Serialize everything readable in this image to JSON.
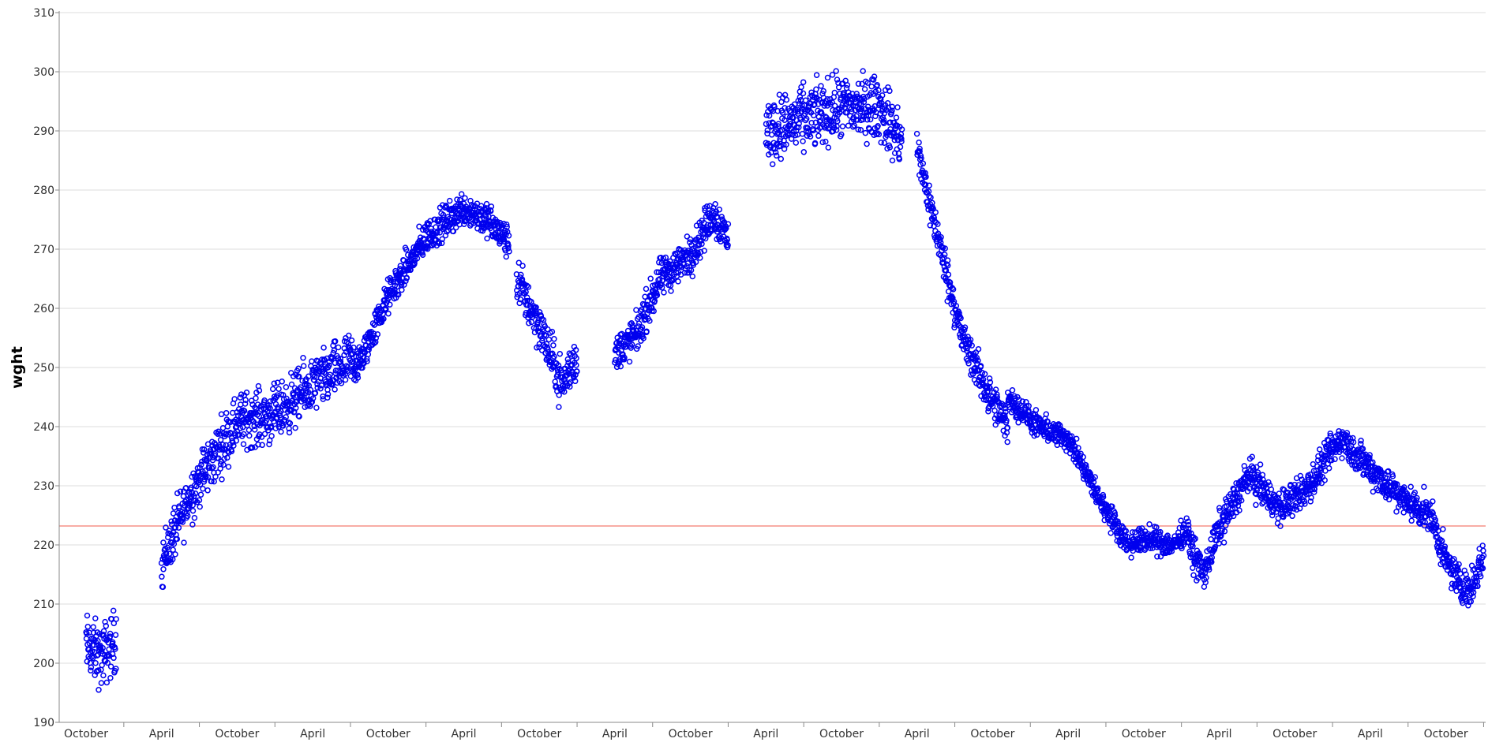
{
  "chart_data": {
    "type": "scatter",
    "ylabel": "wght",
    "xlabel": "",
    "ylim": [
      190,
      310
    ],
    "y_ticks": [
      190,
      200,
      210,
      220,
      230,
      240,
      250,
      260,
      270,
      280,
      290,
      300,
      310
    ],
    "x_ticks": [
      "October",
      "April",
      "October",
      "April",
      "October",
      "April",
      "October",
      "April",
      "October",
      "April",
      "October",
      "April",
      "October",
      "April",
      "October",
      "April",
      "October",
      "April",
      "October"
    ],
    "reference_line": {
      "value": 223.2,
      "color": "#f47b6f"
    },
    "marker_color": "#0000ee",
    "grid": true,
    "series_segments": [
      {
        "start_tick": 0,
        "end_tick": 0.4,
        "anchors": [
          [
            0,
            203
          ],
          [
            0.2,
            201
          ],
          [
            0.4,
            204
          ]
        ],
        "spread": 4
      },
      {
        "start_tick": 1,
        "end_tick": 3.6,
        "anchors": [
          [
            1,
            217
          ],
          [
            1.4,
            229
          ],
          [
            2,
            241
          ],
          [
            2.5,
            242
          ],
          [
            3,
            247
          ],
          [
            3.5,
            251
          ]
        ],
        "spread": 3.5
      },
      {
        "start_tick": 3.6,
        "end_tick": 5.6,
        "anchors": [
          [
            3.6,
            250
          ],
          [
            4,
            262
          ],
          [
            4.5,
            272
          ],
          [
            5,
            277
          ],
          [
            5.3,
            275
          ],
          [
            5.6,
            271
          ]
        ],
        "spread": 2.2
      },
      {
        "start_tick": 5.7,
        "end_tick": 6.5,
        "anchors": [
          [
            5.7,
            265
          ],
          [
            6,
            257
          ],
          [
            6.3,
            247
          ],
          [
            6.5,
            252
          ]
        ],
        "spread": 3
      },
      {
        "start_tick": 7,
        "end_tick": 8.5,
        "anchors": [
          [
            7,
            252
          ],
          [
            7.3,
            256
          ],
          [
            7.6,
            265
          ],
          [
            8,
            269
          ],
          [
            8.3,
            276
          ],
          [
            8.5,
            272
          ]
        ],
        "spread": 2.5
      },
      {
        "start_tick": 9,
        "end_tick": 10.8,
        "anchors": [
          [
            9,
            290
          ],
          [
            9.5,
            292
          ],
          [
            10,
            294
          ],
          [
            10.5,
            294
          ],
          [
            10.8,
            288
          ]
        ],
        "spread": 4
      },
      {
        "start_tick": 11,
        "end_tick": 12.2,
        "anchors": [
          [
            11,
            287
          ],
          [
            11.2,
            276
          ],
          [
            11.6,
            255
          ],
          [
            12,
            244
          ],
          [
            12.2,
            240
          ]
        ],
        "spread": 2.5
      },
      {
        "start_tick": 12.2,
        "end_tick": 14.6,
        "anchors": [
          [
            12.2,
            245
          ],
          [
            12.6,
            240
          ],
          [
            13,
            238
          ],
          [
            13.4,
            228
          ],
          [
            13.8,
            220
          ],
          [
            14,
            221
          ],
          [
            14.4,
            220
          ],
          [
            14.6,
            223
          ]
        ],
        "spread": 1.6
      },
      {
        "start_tick": 14.6,
        "end_tick": 18.5,
        "anchors": [
          [
            14.6,
            220
          ],
          [
            14.8,
            215
          ],
          [
            15,
            223
          ],
          [
            15.4,
            232
          ],
          [
            15.8,
            226
          ],
          [
            16.2,
            230
          ],
          [
            16.6,
            238
          ],
          [
            17,
            233
          ],
          [
            17.4,
            228
          ],
          [
            17.8,
            225
          ],
          [
            18,
            217
          ],
          [
            18.3,
            212
          ],
          [
            18.5,
            218
          ]
        ],
        "spread": 2.2
      }
    ]
  }
}
